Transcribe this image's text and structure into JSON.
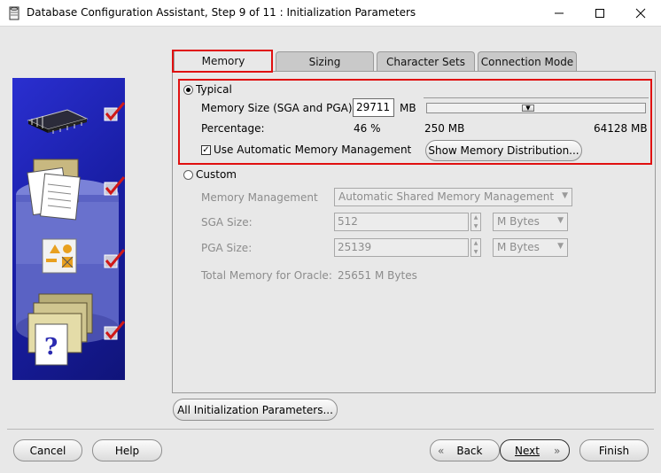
{
  "window": {
    "title": "Database Configuration Assistant, Step 9 of 11 : Initialization Parameters",
    "icon": "database-app-icon",
    "controls": [
      "minimize-icon",
      "maximize-icon",
      "close-icon"
    ]
  },
  "tabs": [
    {
      "label": "Memory",
      "selected": true
    },
    {
      "label": "Sizing",
      "selected": false
    },
    {
      "label": "Character Sets",
      "selected": false
    },
    {
      "label": "Connection Mode",
      "selected": false
    }
  ],
  "memory": {
    "typical": {
      "label": "Typical",
      "selected": true,
      "memory_size_label": "Memory Size (SGA and PGA):",
      "memory_size_value": "29711",
      "memory_size_unit": "MB",
      "slider_min": "250 MB",
      "slider_max": "64128 MB",
      "slider_fraction": 0.46,
      "percentage_label": "Percentage:",
      "percentage_value": "46 %",
      "auto_mgmt_label": "Use Automatic Memory Management",
      "auto_mgmt_checked": true,
      "show_distribution_label": "Show Memory Distribution..."
    },
    "custom": {
      "label": "Custom",
      "selected": false,
      "memory_management_label": "Memory Management",
      "memory_management_value": "Automatic Shared Memory Management",
      "sga_label": "SGA Size:",
      "sga_value": "512",
      "sga_unit": "M Bytes",
      "pga_label": "PGA Size:",
      "pga_value": "25139",
      "pga_unit": "M Bytes",
      "total_label": "Total Memory for Oracle:",
      "total_value": "25651 M Bytes"
    }
  },
  "all_params_label": "All Initialization Parameters...",
  "footer": {
    "cancel": "Cancel",
    "help": "Help",
    "back": "Back",
    "next": "Next",
    "finish": "Finish"
  },
  "colors": {
    "highlight_box": "#e01010",
    "panel_blue": "#1a1fa8",
    "check_red": "#d01818"
  }
}
